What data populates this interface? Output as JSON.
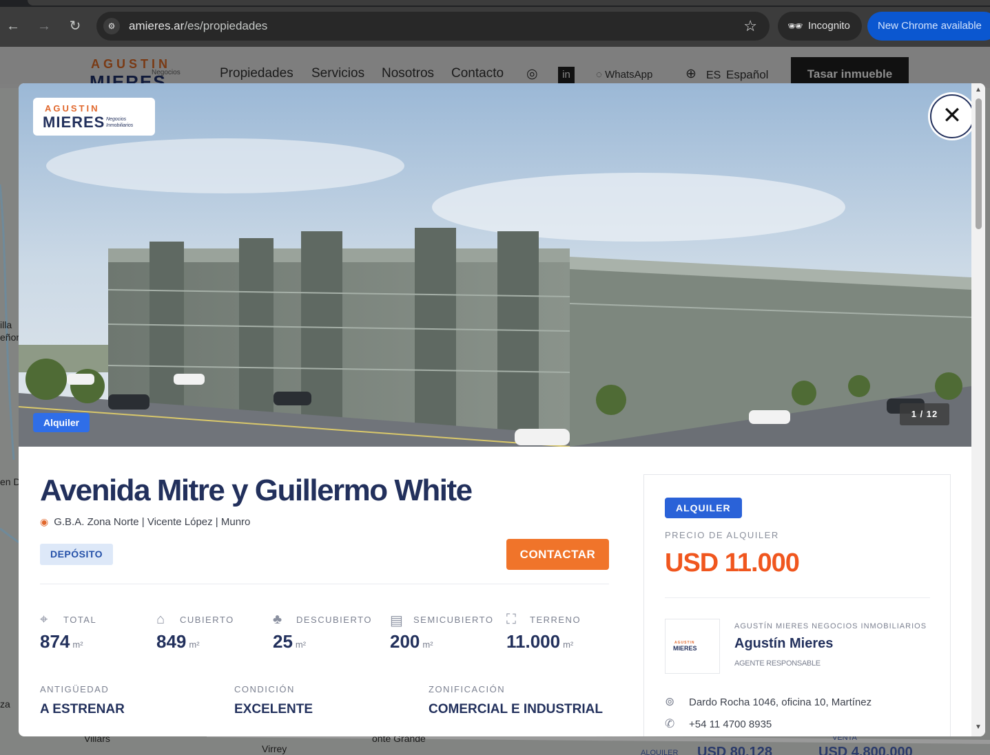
{
  "browser": {
    "url_domain": "amieres.ar",
    "url_path": "/es/propiedades",
    "incognito_label": "Incognito",
    "new_chrome_label": "New Chrome available"
  },
  "site": {
    "logo_top": "AGUSTIN",
    "logo_bottom": "MIERES",
    "logo_sub": "Negocios",
    "nav": [
      "Propiedades",
      "Servicios",
      "Nosotros",
      "Contacto"
    ],
    "whatsapp": "WhatsApp",
    "lang_code": "ES",
    "lang_name": "Español",
    "cta": "Tasar inmueble",
    "map_labels": [
      "illa",
      "eñor",
      "en D",
      "za",
      "Villars",
      "Virrey",
      "onte Grande",
      "ALQUILER",
      "USD 80.128",
      "VENTA",
      "USD 4.800.000"
    ]
  },
  "modal": {
    "hero_logo_top": "AGUSTIN",
    "hero_logo_bottom": "MIERES",
    "hero_logo_sub1": "Negocios",
    "hero_logo_sub2": "Inmobiliarios",
    "image_badge": "Alquiler",
    "counter": "1 / 12",
    "title": "Avenida Mitre y Guillermo White",
    "location": "G.B.A. Zona Norte | Vicente López | Munro",
    "property_type": "DEPÓSITO",
    "contact_button": "CONTACTAR",
    "stats": [
      {
        "label": "TOTAL",
        "value": "874",
        "unit": "m²",
        "icon": "area-icon"
      },
      {
        "label": "CUBIERTO",
        "value": "849",
        "unit": "m²",
        "icon": "covered-icon"
      },
      {
        "label": "DESCUBIERTO",
        "value": "25",
        "unit": "m²",
        "icon": "tree-icon"
      },
      {
        "label": "SEMICUBIERTO",
        "value": "200",
        "unit": "m²",
        "icon": "semi-covered-icon"
      },
      {
        "label": "TERRENO",
        "value": "11.000",
        "unit": "m²",
        "icon": "land-icon"
      }
    ],
    "attributes": [
      {
        "label": "ANTIGÜEDAD",
        "value": "A ESTRENAR"
      },
      {
        "label": "CONDICIÓN",
        "value": "EXCELENTE"
      },
      {
        "label": "ZONIFICACIÓN",
        "value": "COMERCIAL E INDUSTRIAL"
      }
    ],
    "side": {
      "badge": "ALQUILER",
      "price_label": "PRECIO DE ALQUILER",
      "price": "USD 11.000",
      "agent_logo_top": "AGUSTIN",
      "agent_logo_bottom": "MIERES",
      "agency": "AGUSTÍN MIERES NEGOCIOS INMOBILIARIOS",
      "agent_name": "Agustín Mieres",
      "agent_role": "AGENTE RESPONSABLE",
      "address": "Dardo Rocha 1046, oficina 10, Martínez",
      "phone": "+54 11 4700 8935"
    }
  },
  "colors": {
    "brand_navy": "#22305c",
    "brand_orange": "#f0742a",
    "price_orange": "#f0561e",
    "badge_blue": "#2a62d8"
  }
}
